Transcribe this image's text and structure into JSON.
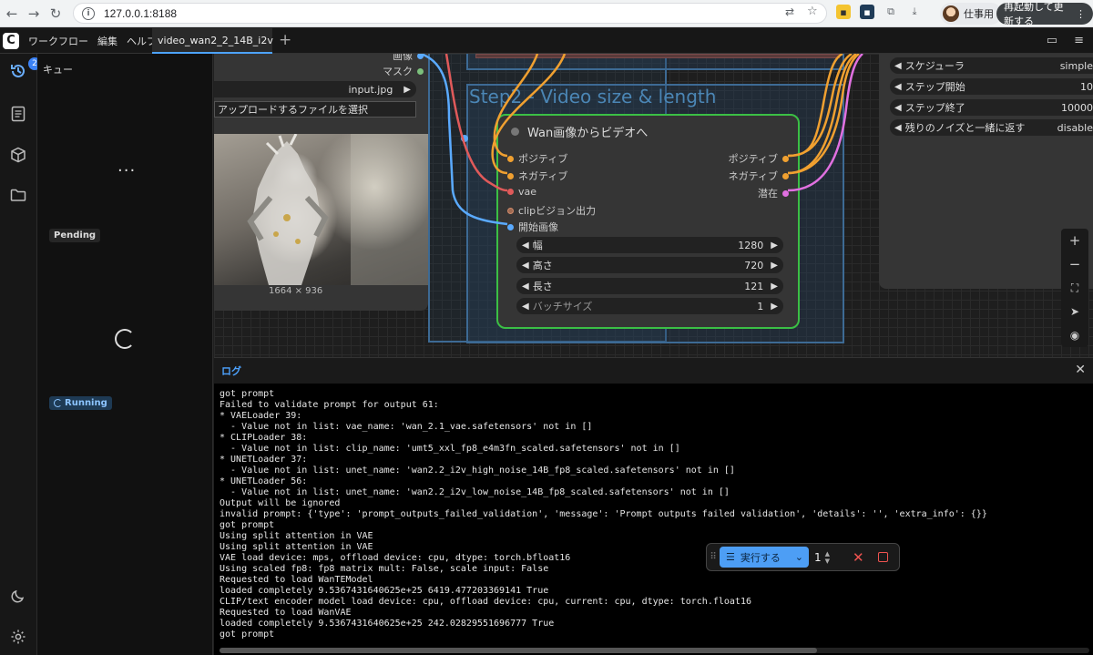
{
  "browser": {
    "url": "127.0.0.1:8188",
    "profile_label": "仕事用",
    "restart_label": "再起動して更新する"
  },
  "menu": {
    "items": [
      "ワークフロー",
      "編集",
      "ヘルプ"
    ],
    "workflow_tab": "video_wan2_2_14B_i2v"
  },
  "sidebar": {
    "queue_badge": "2"
  },
  "queue": {
    "title": "キュー",
    "pending_label": "Pending",
    "running_label": "Running"
  },
  "load_image_node": {
    "outputs": [
      "画像",
      "マスク"
    ],
    "filename": "input.jpg",
    "upload_label": "アップロードするファイルを選択",
    "image_size": "1664 × 936"
  },
  "group": {
    "title": "Step2 - Video size & length"
  },
  "wan_node": {
    "title": "Wan画像からビデオへ",
    "inputs": [
      "ポジティブ",
      "ネガティブ",
      "vae",
      "clipビジョン出力",
      "開始画像"
    ],
    "outputs": [
      "ポジティブ",
      "ネガティブ",
      "潜在"
    ],
    "widgets": [
      {
        "label": "幅",
        "value": "1280"
      },
      {
        "label": "高さ",
        "value": "720"
      },
      {
        "label": "長さ",
        "value": "121"
      },
      {
        "label": "バッチサイズ",
        "value": "1"
      }
    ]
  },
  "sampler_node": {
    "widgets": [
      {
        "label": "スケジューラ",
        "value": "simple"
      },
      {
        "label": "ステップ開始",
        "value": "10"
      },
      {
        "label": "ステップ終了",
        "value": "10000"
      },
      {
        "label": "残りのノイズと一緒に返す",
        "value": "disable"
      }
    ]
  },
  "log": {
    "title": "ログ",
    "lines": [
      "got prompt",
      "Failed to validate prompt for output 61:",
      "* VAELoader 39:",
      "  - Value not in list: vae_name: 'wan_2.1_vae.safetensors' not in []",
      "* CLIPLoader 38:",
      "  - Value not in list: clip_name: 'umt5_xxl_fp8_e4m3fn_scaled.safetensors' not in []",
      "* UNETLoader 37:",
      "  - Value not in list: unet_name: 'wan2.2_i2v_high_noise_14B_fp8_scaled.safetensors' not in []",
      "* UNETLoader 56:",
      "  - Value not in list: unet_name: 'wan2.2_i2v_low_noise_14B_fp8_scaled.safetensors' not in []",
      "Output will be ignored",
      "invalid prompt: {'type': 'prompt_outputs_failed_validation', 'message': 'Prompt outputs failed validation', 'details': '', 'extra_info': {}}",
      "got prompt",
      "Using split attention in VAE",
      "Using split attention in VAE",
      "VAE load device: mps, offload device: cpu, dtype: torch.bfloat16",
      "Using scaled fp8: fp8 matrix mult: False, scale input: False",
      "Requested to load WanTEModel",
      "loaded completely 9.5367431640625e+25 6419.477203369141 True",
      "CLIP/text encoder model load device: cpu, offload device: cpu, current: cpu, dtype: torch.float16",
      "Requested to load WanVAE",
      "loaded completely 9.5367431640625e+25 242.02829551696777 True",
      "got prompt"
    ]
  },
  "run_toolbar": {
    "run_label": "実行する",
    "batch_count": "1"
  },
  "colors": {
    "accent": "#4d9ef5",
    "node_border_active": "#3bbf45",
    "group_border": "#3d6a94",
    "wire_conditioning": "#f0a030",
    "wire_latent": "#e070e0",
    "wire_vae": "#e05a5a",
    "wire_image": "#5aaaff"
  }
}
